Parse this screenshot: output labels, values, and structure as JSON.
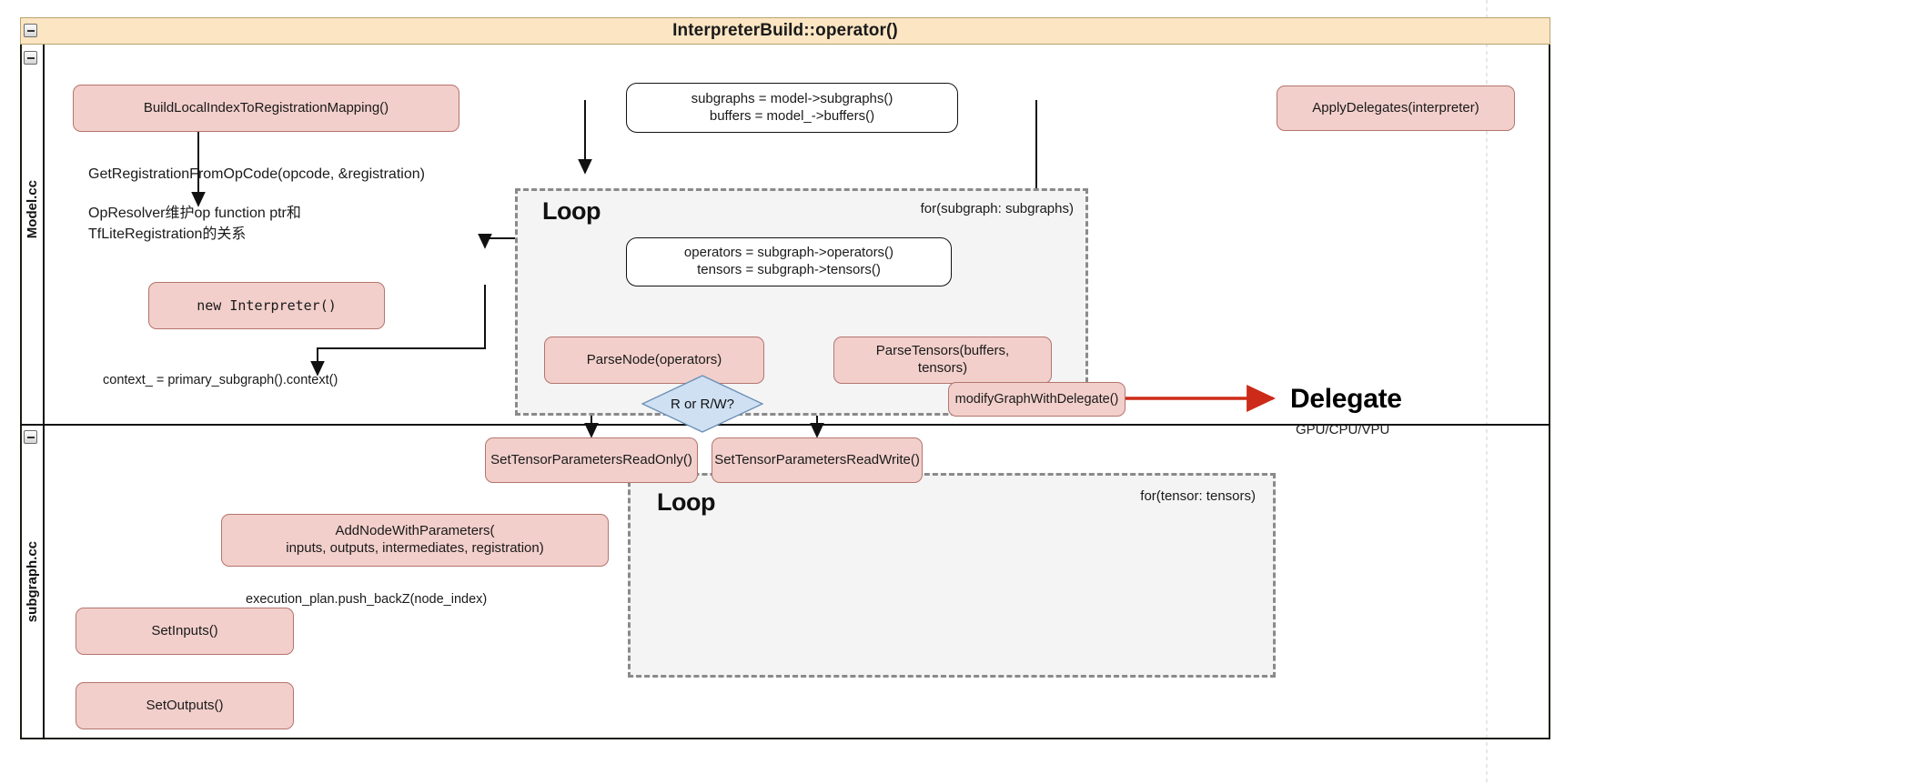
{
  "frame": {
    "title": "InterpreterBuild::operator()",
    "collapse_icon": "minus-icon",
    "lanes": [
      {
        "label": "Model.cc"
      },
      {
        "label": "subgraph.cc"
      }
    ]
  },
  "model_lane": {
    "build_mapping_node": "BuildLocalIndexToRegistrationMapping()",
    "note_get_registration": "GetRegistrationFromOpCode(opcode, &registration)",
    "note_opresolver": "OpResolver维护op function ptr和\nTfLiteRegistration的关系",
    "new_interpreter_node": "new Interpreter()",
    "note_context": "context_ = primary_subgraph().context()",
    "model_subgraphs_node": "subgraphs = model->subgraphs()\nbuffers = model_->buffers()",
    "apply_delegates_node": "ApplyDelegates(interpreter)",
    "loop": {
      "title": "Loop",
      "condition": "for(subgraph: subgraphs)",
      "subgraph_vars_node": "operators = subgraph->operators()\ntensors = subgraph->tensors()",
      "parse_node": "ParseNode(operators)",
      "parse_tensors_node": "ParseTensors(buffers,\ntensors)"
    }
  },
  "subgraph_lane": {
    "add_node_with_parameters": "AddNodeWithParameters(\ninputs, outputs, intermediates, registration)",
    "note_execution_plan": "execution_plan.push_backZ(node_index)",
    "set_inputs_node": "SetInputs()",
    "set_outputs_node": "SetOutputs()",
    "modify_graph_node": "modifyGraphWithDelegate()",
    "loop": {
      "title": "Loop",
      "condition": "for(tensor: tensors)",
      "decision": "R or R/W?",
      "read_only_node": "SetTensorParametersReadOnly()",
      "read_write_node": "SetTensorParametersReadWrite()"
    }
  },
  "delegate": {
    "title": "Delegate",
    "subtitle": "GPU/CPU/VPU"
  },
  "colors": {
    "node_fill": "#f2cfcb",
    "node_stroke": "#b4756e",
    "header_fill": "#fbe5c3",
    "header_stroke": "#b9a36d",
    "loop_fill": "#f4f4f4",
    "loop_stroke": "#8a8a8a",
    "diamond_fill": "#cfe0f3",
    "diamond_stroke": "#6b8fb5",
    "delegate_arrow": "#cc2b19",
    "edge": "#111111"
  }
}
